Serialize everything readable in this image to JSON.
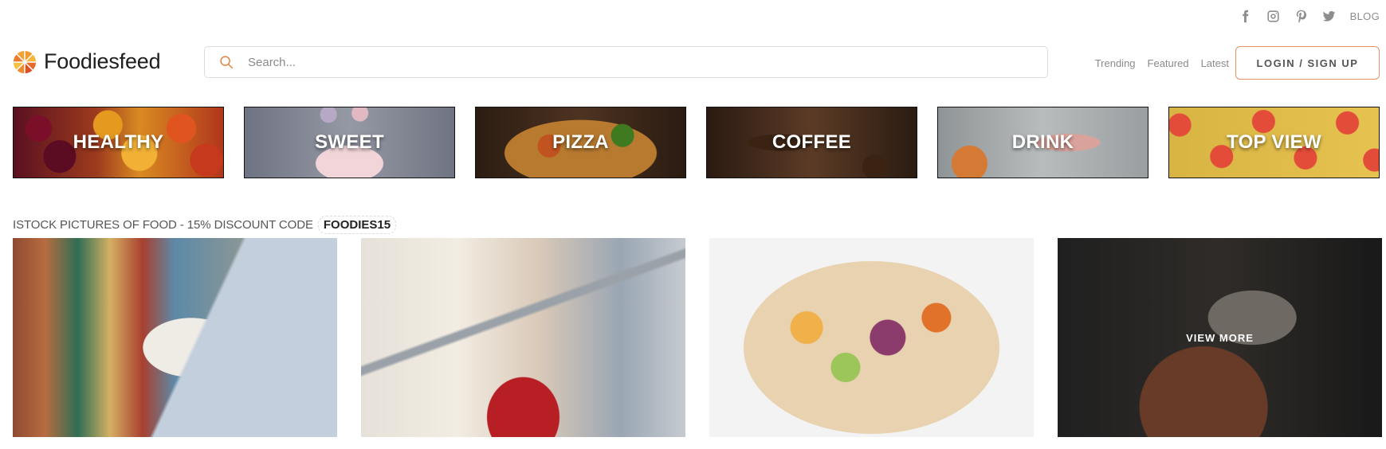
{
  "social": {
    "icons": [
      "facebook-icon",
      "instagram-icon",
      "pinterest-icon",
      "twitter-icon"
    ],
    "blog_label": "BLOG",
    "icon_color": "#8d8d8d"
  },
  "header": {
    "logo_text": "Foodiesfeed",
    "search_placeholder": "Search...",
    "nav": {
      "trending": "Trending",
      "featured": "Featured",
      "latest": "Latest"
    },
    "login_label": "LOGIN / SIGN UP",
    "accent_color": "#e99268"
  },
  "categories": [
    {
      "label": "HEALTHY"
    },
    {
      "label": "SWEET"
    },
    {
      "label": "PIZZA"
    },
    {
      "label": "COFFEE"
    },
    {
      "label": "DRINK"
    },
    {
      "label": "TOP VIEW"
    }
  ],
  "promo": {
    "text": "ISTOCK PICTURES OF FOOD - 15% DISCOUNT CODE",
    "code": "FOODIES15"
  },
  "photos": {
    "view_more_label": "VIEW MORE"
  }
}
